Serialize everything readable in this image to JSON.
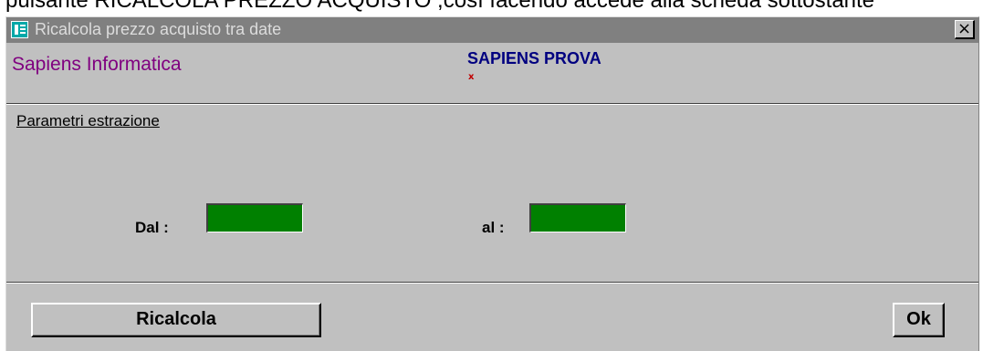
{
  "document": {
    "partial_text": "pulsante RICALCOLA PREZZO ACQUISTO ,così facendo accede alla scheda sottostante"
  },
  "window": {
    "title": "Ricalcola prezzo acquisto tra date",
    "close_label": "×"
  },
  "header": {
    "company": "Sapiens Informatica",
    "database": "SAPIENS PROVA",
    "database_marker": "x"
  },
  "section": {
    "label": "Parametri estrazione"
  },
  "fields": {
    "from_label": "Dal :",
    "from_value": "",
    "to_label": "al :",
    "to_value": ""
  },
  "buttons": {
    "recalc_label": "Ricalcola",
    "ok_label": "Ok"
  },
  "colors": {
    "field_background": "#008000",
    "company_text": "#800080",
    "database_text": "#000080",
    "titlebar": "#808080"
  },
  "icons": {
    "window_icon": "form-window-icon",
    "close": "close-icon"
  }
}
